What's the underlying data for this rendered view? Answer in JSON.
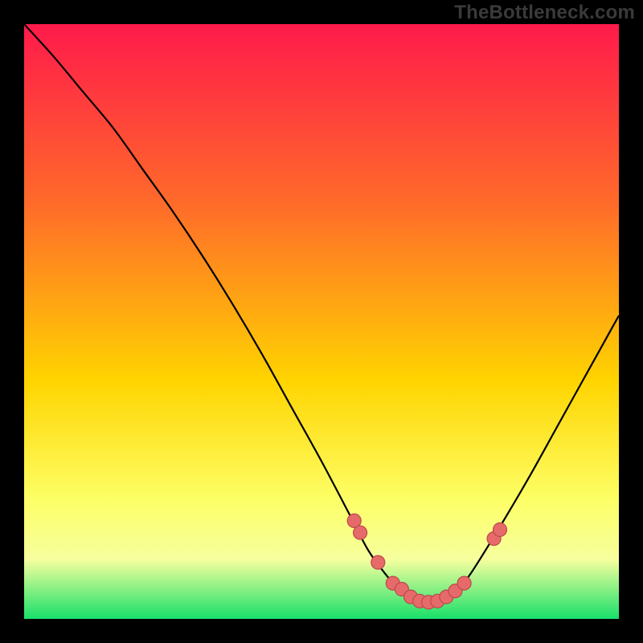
{
  "watermark": "TheBottleneck.com",
  "colors": {
    "bg": "#000000",
    "grad_top": "#ff1a4b",
    "grad_mid1": "#ff6a2a",
    "grad_mid2": "#ffd400",
    "grad_low": "#fdff66",
    "grad_band": "#f6ff9e",
    "grad_bottom": "#18e06a",
    "curve": "#000000",
    "marker_fill": "#e76a6a",
    "marker_stroke": "#bb4a4a"
  },
  "chart_data": {
    "type": "line",
    "title": "",
    "xlabel": "",
    "ylabel": "",
    "xlim": [
      0,
      1
    ],
    "ylim": [
      0,
      1
    ],
    "series": [
      {
        "name": "bottleneck-curve",
        "x": [
          0.0,
          0.05,
          0.1,
          0.15,
          0.2,
          0.25,
          0.3,
          0.35,
          0.4,
          0.45,
          0.5,
          0.55,
          0.577,
          0.6,
          0.625,
          0.65,
          0.675,
          0.7,
          0.725,
          0.75,
          0.8,
          0.85,
          0.9,
          0.95,
          1.0
        ],
        "y": [
          1.0,
          0.945,
          0.885,
          0.825,
          0.755,
          0.685,
          0.61,
          0.53,
          0.445,
          0.355,
          0.265,
          0.17,
          0.118,
          0.085,
          0.055,
          0.035,
          0.028,
          0.03,
          0.045,
          0.075,
          0.155,
          0.24,
          0.33,
          0.42,
          0.51
        ]
      }
    ],
    "markers": {
      "name": "highlight-points",
      "x": [
        0.555,
        0.565,
        0.595,
        0.62,
        0.635,
        0.65,
        0.665,
        0.68,
        0.695,
        0.71,
        0.725,
        0.74,
        0.79,
        0.8
      ],
      "y": [
        0.165,
        0.145,
        0.095,
        0.06,
        0.05,
        0.037,
        0.03,
        0.028,
        0.03,
        0.037,
        0.047,
        0.06,
        0.135,
        0.15
      ]
    },
    "gradient_stops": [
      {
        "offset": 0.0,
        "color": "#ff1a4b"
      },
      {
        "offset": 0.3,
        "color": "#ff6a2a"
      },
      {
        "offset": 0.6,
        "color": "#ffd400"
      },
      {
        "offset": 0.8,
        "color": "#fdff66"
      },
      {
        "offset": 0.9,
        "color": "#f6ff9e"
      },
      {
        "offset": 1.0,
        "color": "#18e06a"
      }
    ]
  }
}
